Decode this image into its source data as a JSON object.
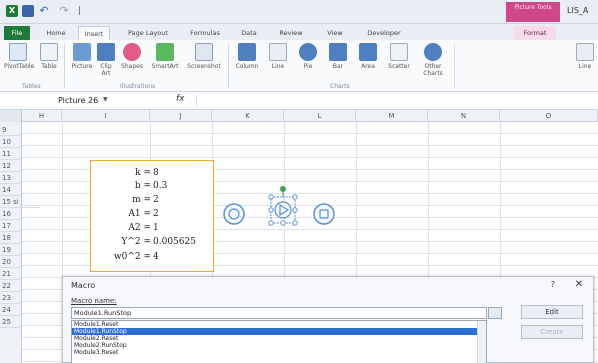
{
  "window": {
    "title": "LIS_A",
    "context_tab": [
      "Picture Tools",
      "Format"
    ],
    "app_icon_letter": "X",
    "qat_separator": "|"
  },
  "tabs": [
    "File",
    "Home",
    "Insert",
    "Page Layout",
    "Formulas",
    "Data",
    "Review",
    "View",
    "Developer"
  ],
  "active_tab": "Insert",
  "ribbon": {
    "buttons": [
      "PivotTable",
      "Table",
      "Picture",
      "Clip Art",
      "Shapes",
      "SmartArt",
      "Screenshot",
      "Column",
      "Line",
      "Pie",
      "Bar",
      "Area",
      "Scatter",
      "Other Charts",
      "Line"
    ],
    "groups": [
      "Tables",
      "Illustrations",
      "Charts"
    ]
  },
  "formula_bar": {
    "name_box": "Picture 26",
    "fx": "fx",
    "formula": ""
  },
  "columns": [
    "H",
    "I",
    "J",
    "K",
    "L",
    "M",
    "N",
    "O"
  ],
  "rows": [
    "9",
    "10",
    "11",
    "12",
    "13",
    "14",
    "15 si",
    "16",
    "17",
    "18",
    "19",
    "20",
    "21",
    "22",
    "23",
    "24",
    "25"
  ],
  "params": [
    {
      "name": "k =",
      "value": "8"
    },
    {
      "name": "b =",
      "value": "0.3"
    },
    {
      "name": "m =",
      "value": "2"
    },
    {
      "name": "A1 =",
      "value": "2"
    },
    {
      "name": "A2 =",
      "value": "1"
    },
    {
      "name": "Y^2 =",
      "value": "0.005625"
    },
    {
      "name": "w0^2 =",
      "value": "4"
    }
  ],
  "macro_dialog": {
    "title": "Macro",
    "help": "?",
    "close": "✕",
    "label": "Macro name:",
    "macro_name": "Module1.RunStop",
    "items": [
      "Module1.Reset",
      "Module1.RunStop",
      "Module2.Reset",
      "Module2.RunStop",
      "Module3.Reset"
    ],
    "selected_index": 1,
    "edit_label": "Edit",
    "create_label": "Create"
  },
  "colors": {
    "accent": "#1f7a3a",
    "selection": "#2f6fd1",
    "textbox_border": "#f0a830",
    "context_tab": "#d0478a",
    "shape_stroke": "#5b8fd6"
  }
}
